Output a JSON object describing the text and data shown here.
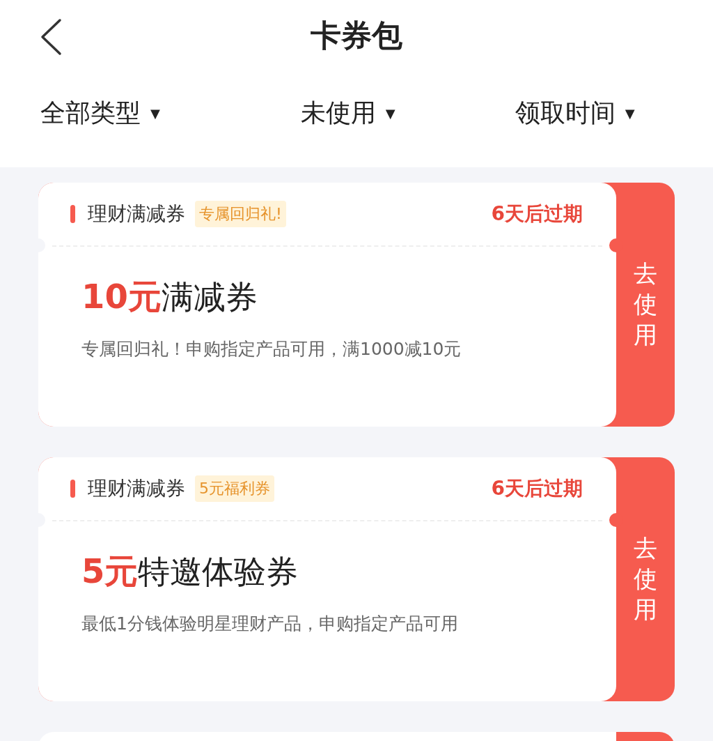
{
  "header": {
    "title": "卡券包"
  },
  "filters": [
    {
      "label": "全部类型",
      "arrow": "▼"
    },
    {
      "label": "未使用",
      "arrow": "▼"
    },
    {
      "label": "领取时间",
      "arrow": "▼"
    }
  ],
  "coupons": [
    {
      "kind": "full",
      "category": "理财满减券",
      "tag": "专属回归礼!",
      "expiry": "6天后过期",
      "amount": "10元",
      "name": "满减券",
      "description": "专属回归礼！申购指定产品可用，满1000减10元",
      "action": "去使用"
    },
    {
      "kind": "full",
      "category": "理财满减券",
      "tag": "5元福利券",
      "expiry": "6天后过期",
      "amount": "5元",
      "name": "特邀体验券",
      "description": "最低1分钱体验明星理财产品，申购指定产品可用",
      "action": "去使用"
    },
    {
      "kind": "cut"
    }
  ]
}
